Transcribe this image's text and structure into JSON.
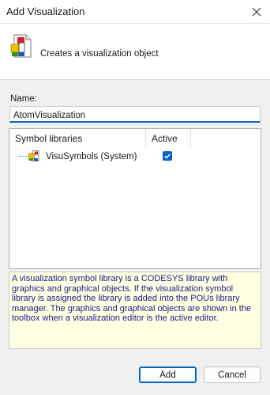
{
  "window": {
    "title": "Add Visualization"
  },
  "header": {
    "description": "Creates a visualization object"
  },
  "form": {
    "name_label": "Name:",
    "name_value": "AtomVisualization"
  },
  "libraries": {
    "columns": {
      "symbol_libraries": "Symbol libraries",
      "active": "Active"
    },
    "rows": [
      {
        "label": "VisuSymbols (System)",
        "active": true
      }
    ]
  },
  "info_text": "A visualization symbol library is a CODESYS library with graphics and graphical objects. If the visualization symbol library is assigned the library is added into the POUs library manager. The graphics and graphical objects are shown in the toolbox when a visualization editor is the active editor.",
  "buttons": {
    "add": "Add",
    "cancel": "Cancel"
  },
  "colors": {
    "accent": "#0067c0",
    "info_background": "#ffffe1",
    "info_text": "#1a1a8c"
  }
}
